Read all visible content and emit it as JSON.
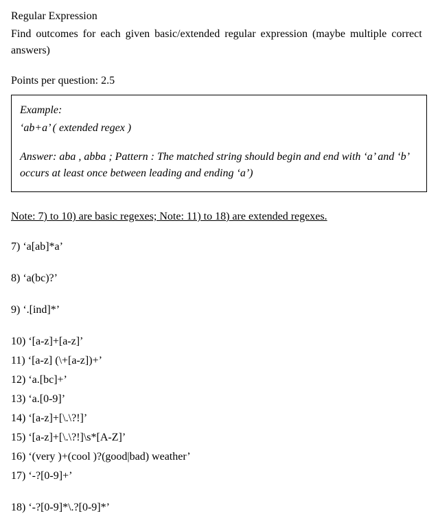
{
  "title": "Regular Expression",
  "instructions": "Find outcomes for each given basic/extended regular expression (maybe multiple correct answers)",
  "points_line": "Points per question: 2.5",
  "example": {
    "label": "Example:",
    "regex_line": "‘ab+a’  ( extended regex )",
    "answer_line": "Answer: aba , abba ; Pattern : The matched string should begin and end with ‘a’  and ‘b’ occurs at least once between leading and ending ‘a’)"
  },
  "note_line": "Note: 7) to 10) are basic regexes;  Note: 11) to 18) are extended regexes.",
  "questions": {
    "q7": "7) ‘a[ab]*a’",
    "q8": "8) ‘a(bc)?’",
    "q9": "9) ‘.[ind]*’",
    "q10": "10) ‘[a-z]+[a-z]’",
    "q11": "11) ‘[a-z] (\\+[a-z])+’",
    "q12": "12) ‘a.[bc]+’",
    "q13": "13) ‘a.[0-9]’",
    "q14": "14) ‘[a-z]+[\\.\\?!]’",
    "q15": "15) ‘[a-z]+[\\.\\?!]\\s*[A-Z]’",
    "q16": "16) ‘(very )+(cool )?(good|bad) weather’",
    "q17": "17) ‘-?[0-9]+’",
    "q18": "18) ‘-?[0-9]*\\.?[0-9]*’"
  }
}
